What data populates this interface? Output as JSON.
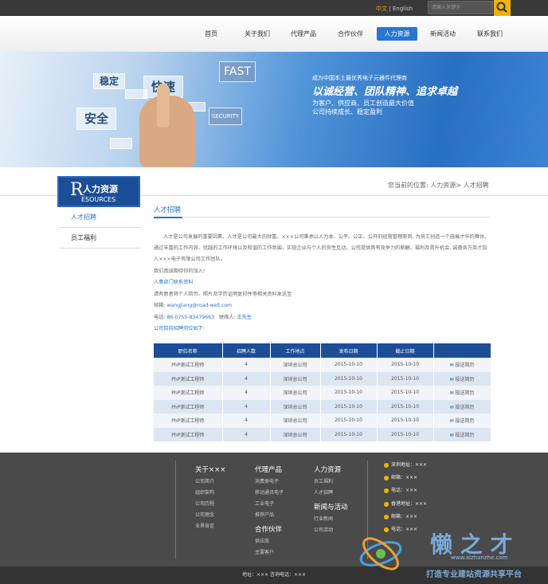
{
  "topbar": {
    "lang_cn": "中文",
    "lang_sep": "|",
    "lang_en": "English",
    "search_placeholder": "请输入关键字"
  },
  "nav": [
    "首页",
    "关于我们",
    "代理产品",
    "合作伙伴",
    "人力资源",
    "新闻活动",
    "联系我们"
  ],
  "nav_active": "人力资源",
  "banner": {
    "tiles": [
      "稳定",
      "快速",
      "FAST",
      "安全",
      "SECURITY"
    ],
    "line1": "成为中国本土最优秀电子元器件代理商",
    "line2": "以诚经营、团队精神、追求卓越",
    "line3": "为客户、供应商、员工创造最大价值",
    "line4": "公司持续成长、稳定盈利"
  },
  "sidebar": {
    "title_letter": "R",
    "title_cn": "人力资源",
    "title_en": "ESOURCES",
    "items": [
      "人才招聘",
      "员工福利"
    ]
  },
  "breadcrumb": "您当前的位置: 人力资源> 人才招聘",
  "section_title": "人才招聘",
  "content": {
    "intro": "人才是公司发展的重要因素，人才是公司最大的财富。×××公司秉承以人为本、公平、公正、公开的经营管理原则, 为员工创造一个施展才华的舞台。通过丰富的工作内容、优越的工作环境以及和谐的工作氛围，实现企业与个人的良性互动。公司提供具有竞争力的薪酬、福利及晋升机会, 诚邀各方英才加入×××电子有限公司工作团队。",
    "welcome": "我们真诚期待你的加入!",
    "hr_contact": "人事部门联系资料",
    "send_note": "请有意者将个人简历、照片及学历证明复印件等相关资料发送至",
    "email_label": "邮箱:",
    "email": "wangjiang@road-well.com",
    "phone_label": "电话:",
    "phone": "86-0755-83479663",
    "contact_label": "联络人:",
    "contact_person": "王先生",
    "positions_intro": "公司目前招聘岗位如下:"
  },
  "table": {
    "headers": [
      "职位名称",
      "招聘人数",
      "工作地点",
      "发布日期",
      "截止日期",
      ""
    ],
    "rows": [
      [
        "PhP测试工程师",
        "4",
        "深圳总公司",
        "2015-10-10",
        "2015-10-10",
        "投送简历"
      ],
      [
        "PhP测试工程师",
        "4",
        "深圳总公司",
        "2015-10-10",
        "2015-10-10",
        "投送简历"
      ],
      [
        "PhP测试工程师",
        "4",
        "深圳总公司",
        "2015-10-10",
        "2015-10-10",
        "投送简历"
      ],
      [
        "PhP测试工程师",
        "4",
        "深圳总公司",
        "2015-10-10",
        "2015-10-10",
        "投送简历"
      ],
      [
        "PhP测试工程师",
        "4",
        "深圳总公司",
        "2015-10-10",
        "2015-10-10",
        "投送简历"
      ],
      [
        "PhP测试工程师",
        "4",
        "深圳总公司",
        "2015-10-10",
        "2015-10-10",
        "投送简历"
      ]
    ]
  },
  "footer": {
    "col1": {
      "title": "关于×××",
      "items": [
        "公司简介",
        "组织架构",
        "公司历程",
        "公司理念",
        "业界肯定"
      ]
    },
    "col2": {
      "title": "代理产品",
      "items": [
        "消费类电子",
        "移动通讯电子",
        "工业电子",
        "推荐产品"
      ]
    },
    "col2b": {
      "title": "合作伙伴",
      "items": [
        "供应商",
        "主要客户"
      ]
    },
    "col3": {
      "title": "人力资源",
      "items": [
        "员工福利",
        "人才招聘"
      ]
    },
    "col3b": {
      "title": "新闻与活动",
      "items": [
        "行业新闻",
        "公司活动"
      ]
    },
    "shenzhen": [
      "深圳地址：×××",
      "邮箱：×××",
      "电话：×××"
    ],
    "hongkong": [
      "香港地址：×××",
      "邮箱：×××",
      "电话：×××"
    ],
    "bottom": "地址：×××   咨询电话：×××"
  },
  "watermark": {
    "title": "懒 之 才",
    "url": "www.aizhanzhe.com",
    "slogan": "打造专业建站资源共享平台"
  },
  "colors": {
    "primary": "#1c4e98",
    "accent": "#2776d0",
    "search_button": "#f2b300"
  }
}
